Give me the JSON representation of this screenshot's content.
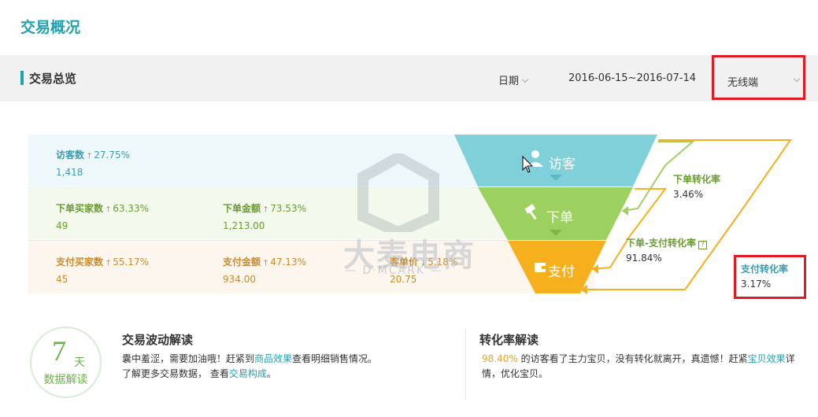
{
  "page_title": "交易概况",
  "filter_bar": {
    "section_title": "交易总览",
    "date_label": "日期",
    "date_range": "2016-06-15~2016-07-14",
    "terminal": "无线端"
  },
  "rows": {
    "visitor": {
      "metrics": [
        {
          "name": "访客数",
          "trend": "up",
          "change": "27.75%",
          "value": "1,418"
        }
      ]
    },
    "order": {
      "metrics": [
        {
          "name": "下单买家数",
          "trend": "up",
          "change": "63.33%",
          "value": "49"
        },
        {
          "name": "下单金额",
          "trend": "up",
          "change": "73.53%",
          "value": "1,213.00"
        }
      ]
    },
    "pay": {
      "metrics": [
        {
          "name": "支付买家数",
          "trend": "up",
          "change": "55.17%",
          "value": "45"
        },
        {
          "name": "支付金额",
          "trend": "up",
          "change": "47.13%",
          "value": "934.00"
        },
        {
          "name": "客单价",
          "trend": "down",
          "change": "5.18%",
          "value": "20.75"
        }
      ]
    }
  },
  "funnel": {
    "stages": [
      "访客",
      "下单",
      "支付"
    ],
    "colors": {
      "visitor": "#7fd0d8",
      "order": "#9dd15f",
      "pay": "#f6b01e"
    },
    "rates": {
      "visit_to_order": {
        "name": "下单转化率",
        "value": "3.46%"
      },
      "order_to_pay": {
        "name": "下单-支付转化率",
        "value": "91.84%"
      },
      "visit_to_pay": {
        "name": "支付转化率",
        "value": "3.17%"
      }
    }
  },
  "watermark": {
    "brand": "大麦电商",
    "sub": "— D·MCARK —"
  },
  "badge": {
    "number": "7",
    "unit": "天",
    "text": "数据解读"
  },
  "panels": {
    "trade": {
      "title": "交易波动解读",
      "line1_a": "囊中羞涩，需要加油哦！赶紧到",
      "line1_link": "商品效果",
      "line1_b": "查看明细销售情况。",
      "line2_a": "了解更多交易数据，  查看",
      "line2_link": "交易构成",
      "line2_b": "。"
    },
    "conversion": {
      "title": "转化率解读",
      "highlight": "98.40%",
      "text_a": " 的访客看了主力宝贝，没有转化就离开，真遗憾！赶紧",
      "link": "宝贝效果",
      "text_b": "详",
      "line2": "情，优化宝贝。"
    }
  }
}
